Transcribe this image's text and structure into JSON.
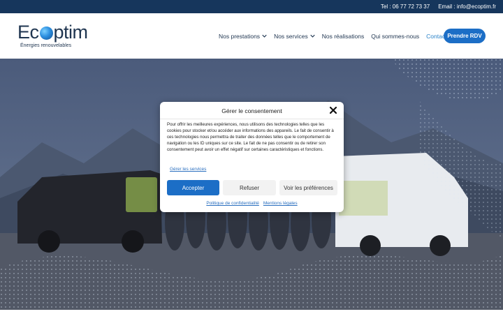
{
  "topbar": {
    "phone": "Tel : 06 77 72 73 37",
    "email": "Email : info@ecoptim.fr"
  },
  "logo": {
    "word_left": "Ec",
    "word_right": "ptim",
    "tagline": "Énergies renouvelables"
  },
  "nav": {
    "items": [
      {
        "label": "Nos prestations",
        "dropdown": true
      },
      {
        "label": "Nos services",
        "dropdown": true
      },
      {
        "label": "Nos réalisations",
        "dropdown": false
      },
      {
        "label": "Qui sommes-nous",
        "dropdown": false
      },
      {
        "label": "Contact",
        "dropdown": false
      }
    ],
    "cta_label": "Prendre RDV"
  },
  "consent": {
    "title": "Gérer le consentement",
    "body": "Pour offrir les meilleures expériences, nous utilisons des technologies telles que les cookies pour stocker et/ou accéder aux informations des appareils. Le fait de consentir à ces technologies nous permettra de traiter des données telles que le comportement de navigation ou les ID uniques sur ce site. Le fait de ne pas consentir ou de retirer son consentement peut avoir un effet négatif sur certaines caractéristiques et fonctions.",
    "services_link": "Gérer les services",
    "accept_label": "Accepter",
    "refuse_label": "Refuser",
    "prefs_label": "Voir les préférences",
    "privacy_link": "Politique de confidentialité",
    "legal_link": "Mentions légales"
  },
  "colors": {
    "topbar": "#16365c",
    "primary": "#1c6ec6",
    "nav_text": "#1f3550",
    "active_nav": "#2a83c9"
  }
}
